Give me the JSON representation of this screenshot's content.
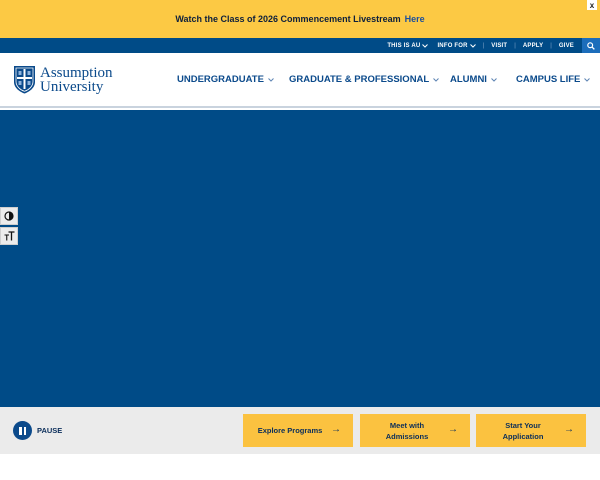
{
  "alert": {
    "message": "Watch the Class of 2026 Commencement Livestream",
    "link_label": "Here",
    "close_label": "x"
  },
  "utility": {
    "items": [
      "THIS IS AU",
      "INFO FOR",
      "VISIT",
      "APPLY",
      "GIVE"
    ]
  },
  "logo": {
    "line1": "Assumption",
    "line2": "University"
  },
  "nav": {
    "items": [
      "UNDERGRADUATE",
      "GRADUATE & PROFESSIONAL",
      "ALUMNI",
      "CAMPUS LIFE"
    ]
  },
  "a11y": {
    "contrast_label": "◑",
    "text_size_label": "тT"
  },
  "hero": {
    "pause_label": "PAUSE"
  },
  "cta": {
    "explore": "Explore Programs",
    "meet_line1": "Meet with",
    "meet_line2": "Admissions",
    "start_line1": "Start Your",
    "start_line2": "Application",
    "arrow": "→"
  },
  "colors": {
    "gold": "#fcc944",
    "navy": "#004b87",
    "text_blue": "#0b4a8b",
    "search_blue": "#1c6dbb"
  },
  "icons": [
    "search-icon",
    "chevron-down-icon",
    "close-icon",
    "contrast-icon",
    "text-size-icon",
    "pause-icon",
    "arrow-right-icon",
    "shield-logo-icon"
  ]
}
